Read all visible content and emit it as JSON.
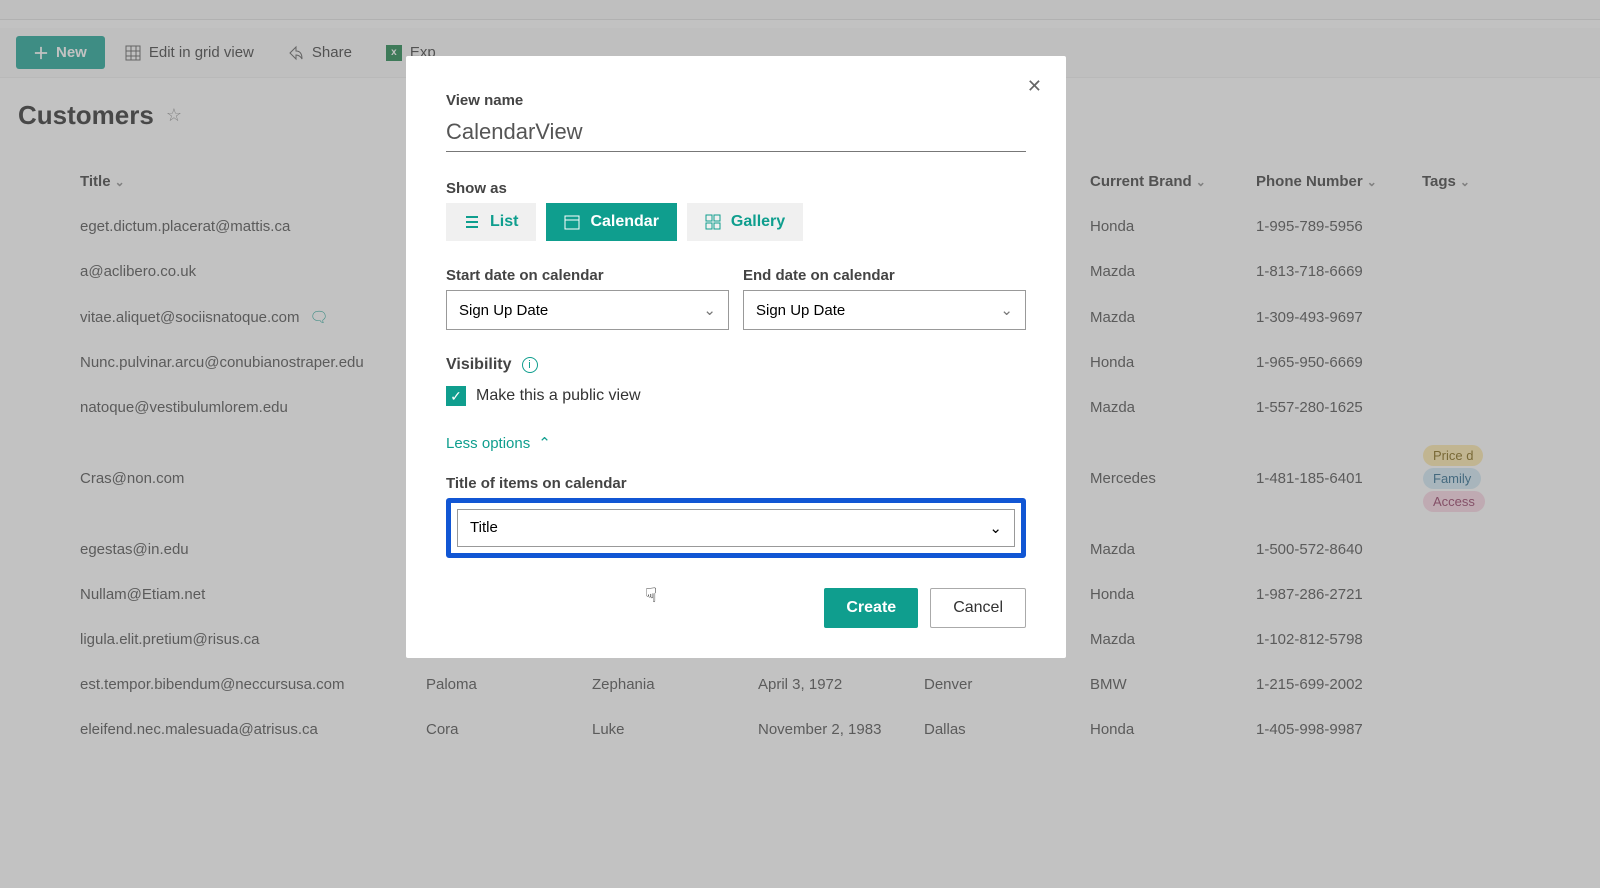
{
  "commandBar": {
    "new": "New",
    "editGrid": "Edit in grid view",
    "share": "Share",
    "export": "Exp"
  },
  "pageTitle": "Customers",
  "columns": {
    "title": "Title",
    "currentBrand": "Current Brand",
    "phone": "Phone Number",
    "tags": "Tags"
  },
  "rows": [
    {
      "title": "eget.dictum.placerat@mattis.ca",
      "brand": "Honda",
      "phone": "1-995-789-5956"
    },
    {
      "title": "a@aclibero.co.uk",
      "brand": "Mazda",
      "phone": "1-813-718-6669"
    },
    {
      "title": "vitae.aliquet@sociisnatoque.com",
      "brand": "Mazda",
      "phone": "1-309-493-9697",
      "comment": true
    },
    {
      "title": "Nunc.pulvinar.arcu@conubianostraper.edu",
      "brand": "Honda",
      "phone": "1-965-950-6669"
    },
    {
      "title": "natoque@vestibulumlorem.edu",
      "brand": "Mazda",
      "phone": "1-557-280-1625"
    },
    {
      "title": "Cras@non.com",
      "brand": "Mercedes",
      "phone": "1-481-185-6401",
      "tags": [
        "Price d",
        "Family",
        "Access"
      ]
    },
    {
      "title": "egestas@in.edu",
      "brand": "Mazda",
      "phone": "1-500-572-8640"
    },
    {
      "title": "Nullam@Etiam.net",
      "brand": "Honda",
      "phone": "1-987-286-2721"
    },
    {
      "title": "ligula.elit.pretium@risus.ca",
      "brand": "Mazda",
      "phone": "1-102-812-5798"
    },
    {
      "title": "est.tempor.bibendum@neccursusa.com",
      "first": "Paloma",
      "last": "Zephania",
      "dob": "April 3, 1972",
      "city": "Denver",
      "brand": "BMW",
      "phone": "1-215-699-2002"
    },
    {
      "title": "eleifend.nec.malesuada@atrisus.ca",
      "first": "Cora",
      "last": "Luke",
      "dob": "November 2, 1983",
      "city": "Dallas",
      "brand": "Honda",
      "phone": "1-405-998-9987"
    }
  ],
  "dialog": {
    "viewNameLabel": "View name",
    "viewNameValue": "CalendarView",
    "showAsLabel": "Show as",
    "listBtn": "List",
    "calendarBtn": "Calendar",
    "galleryBtn": "Gallery",
    "startDateLabel": "Start date on calendar",
    "endDateLabel": "End date on calendar",
    "startDateValue": "Sign Up Date",
    "endDateValue": "Sign Up Date",
    "visibilityLabel": "Visibility",
    "publicCheckLabel": "Make this a public view",
    "lessOptions": "Less options",
    "titleItemsLabel": "Title of items on calendar",
    "titleItemsValue": "Title",
    "createBtn": "Create",
    "cancelBtn": "Cancel"
  }
}
